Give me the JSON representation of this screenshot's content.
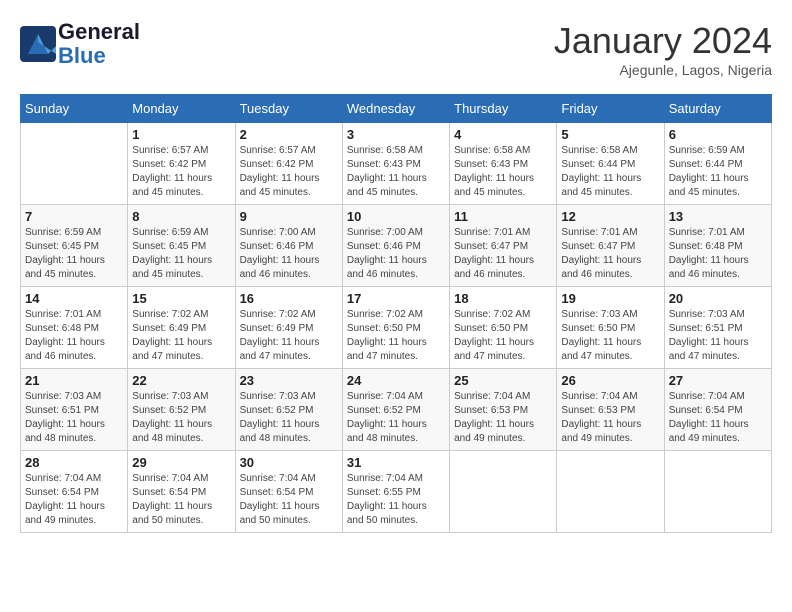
{
  "logo": {
    "text_general": "General",
    "text_blue": "Blue"
  },
  "title": "January 2024",
  "subtitle": "Ajegunle, Lagos, Nigeria",
  "days_header": [
    "Sunday",
    "Monday",
    "Tuesday",
    "Wednesday",
    "Thursday",
    "Friday",
    "Saturday"
  ],
  "weeks": [
    [
      {
        "day": "",
        "sunrise": "",
        "sunset": "",
        "daylight": ""
      },
      {
        "day": "1",
        "sunrise": "Sunrise: 6:57 AM",
        "sunset": "Sunset: 6:42 PM",
        "daylight": "Daylight: 11 hours and 45 minutes."
      },
      {
        "day": "2",
        "sunrise": "Sunrise: 6:57 AM",
        "sunset": "Sunset: 6:42 PM",
        "daylight": "Daylight: 11 hours and 45 minutes."
      },
      {
        "day": "3",
        "sunrise": "Sunrise: 6:58 AM",
        "sunset": "Sunset: 6:43 PM",
        "daylight": "Daylight: 11 hours and 45 minutes."
      },
      {
        "day": "4",
        "sunrise": "Sunrise: 6:58 AM",
        "sunset": "Sunset: 6:43 PM",
        "daylight": "Daylight: 11 hours and 45 minutes."
      },
      {
        "day": "5",
        "sunrise": "Sunrise: 6:58 AM",
        "sunset": "Sunset: 6:44 PM",
        "daylight": "Daylight: 11 hours and 45 minutes."
      },
      {
        "day": "6",
        "sunrise": "Sunrise: 6:59 AM",
        "sunset": "Sunset: 6:44 PM",
        "daylight": "Daylight: 11 hours and 45 minutes."
      }
    ],
    [
      {
        "day": "7",
        "sunrise": "Sunrise: 6:59 AM",
        "sunset": "Sunset: 6:45 PM",
        "daylight": "Daylight: 11 hours and 45 minutes."
      },
      {
        "day": "8",
        "sunrise": "Sunrise: 6:59 AM",
        "sunset": "Sunset: 6:45 PM",
        "daylight": "Daylight: 11 hours and 45 minutes."
      },
      {
        "day": "9",
        "sunrise": "Sunrise: 7:00 AM",
        "sunset": "Sunset: 6:46 PM",
        "daylight": "Daylight: 11 hours and 46 minutes."
      },
      {
        "day": "10",
        "sunrise": "Sunrise: 7:00 AM",
        "sunset": "Sunset: 6:46 PM",
        "daylight": "Daylight: 11 hours and 46 minutes."
      },
      {
        "day": "11",
        "sunrise": "Sunrise: 7:01 AM",
        "sunset": "Sunset: 6:47 PM",
        "daylight": "Daylight: 11 hours and 46 minutes."
      },
      {
        "day": "12",
        "sunrise": "Sunrise: 7:01 AM",
        "sunset": "Sunset: 6:47 PM",
        "daylight": "Daylight: 11 hours and 46 minutes."
      },
      {
        "day": "13",
        "sunrise": "Sunrise: 7:01 AM",
        "sunset": "Sunset: 6:48 PM",
        "daylight": "Daylight: 11 hours and 46 minutes."
      }
    ],
    [
      {
        "day": "14",
        "sunrise": "Sunrise: 7:01 AM",
        "sunset": "Sunset: 6:48 PM",
        "daylight": "Daylight: 11 hours and 46 minutes."
      },
      {
        "day": "15",
        "sunrise": "Sunrise: 7:02 AM",
        "sunset": "Sunset: 6:49 PM",
        "daylight": "Daylight: 11 hours and 47 minutes."
      },
      {
        "day": "16",
        "sunrise": "Sunrise: 7:02 AM",
        "sunset": "Sunset: 6:49 PM",
        "daylight": "Daylight: 11 hours and 47 minutes."
      },
      {
        "day": "17",
        "sunrise": "Sunrise: 7:02 AM",
        "sunset": "Sunset: 6:50 PM",
        "daylight": "Daylight: 11 hours and 47 minutes."
      },
      {
        "day": "18",
        "sunrise": "Sunrise: 7:02 AM",
        "sunset": "Sunset: 6:50 PM",
        "daylight": "Daylight: 11 hours and 47 minutes."
      },
      {
        "day": "19",
        "sunrise": "Sunrise: 7:03 AM",
        "sunset": "Sunset: 6:50 PM",
        "daylight": "Daylight: 11 hours and 47 minutes."
      },
      {
        "day": "20",
        "sunrise": "Sunrise: 7:03 AM",
        "sunset": "Sunset: 6:51 PM",
        "daylight": "Daylight: 11 hours and 47 minutes."
      }
    ],
    [
      {
        "day": "21",
        "sunrise": "Sunrise: 7:03 AM",
        "sunset": "Sunset: 6:51 PM",
        "daylight": "Daylight: 11 hours and 48 minutes."
      },
      {
        "day": "22",
        "sunrise": "Sunrise: 7:03 AM",
        "sunset": "Sunset: 6:52 PM",
        "daylight": "Daylight: 11 hours and 48 minutes."
      },
      {
        "day": "23",
        "sunrise": "Sunrise: 7:03 AM",
        "sunset": "Sunset: 6:52 PM",
        "daylight": "Daylight: 11 hours and 48 minutes."
      },
      {
        "day": "24",
        "sunrise": "Sunrise: 7:04 AM",
        "sunset": "Sunset: 6:52 PM",
        "daylight": "Daylight: 11 hours and 48 minutes."
      },
      {
        "day": "25",
        "sunrise": "Sunrise: 7:04 AM",
        "sunset": "Sunset: 6:53 PM",
        "daylight": "Daylight: 11 hours and 49 minutes."
      },
      {
        "day": "26",
        "sunrise": "Sunrise: 7:04 AM",
        "sunset": "Sunset: 6:53 PM",
        "daylight": "Daylight: 11 hours and 49 minutes."
      },
      {
        "day": "27",
        "sunrise": "Sunrise: 7:04 AM",
        "sunset": "Sunset: 6:54 PM",
        "daylight": "Daylight: 11 hours and 49 minutes."
      }
    ],
    [
      {
        "day": "28",
        "sunrise": "Sunrise: 7:04 AM",
        "sunset": "Sunset: 6:54 PM",
        "daylight": "Daylight: 11 hours and 49 minutes."
      },
      {
        "day": "29",
        "sunrise": "Sunrise: 7:04 AM",
        "sunset": "Sunset: 6:54 PM",
        "daylight": "Daylight: 11 hours and 50 minutes."
      },
      {
        "day": "30",
        "sunrise": "Sunrise: 7:04 AM",
        "sunset": "Sunset: 6:54 PM",
        "daylight": "Daylight: 11 hours and 50 minutes."
      },
      {
        "day": "31",
        "sunrise": "Sunrise: 7:04 AM",
        "sunset": "Sunset: 6:55 PM",
        "daylight": "Daylight: 11 hours and 50 minutes."
      },
      {
        "day": "",
        "sunrise": "",
        "sunset": "",
        "daylight": ""
      },
      {
        "day": "",
        "sunrise": "",
        "sunset": "",
        "daylight": ""
      },
      {
        "day": "",
        "sunrise": "",
        "sunset": "",
        "daylight": ""
      }
    ]
  ]
}
